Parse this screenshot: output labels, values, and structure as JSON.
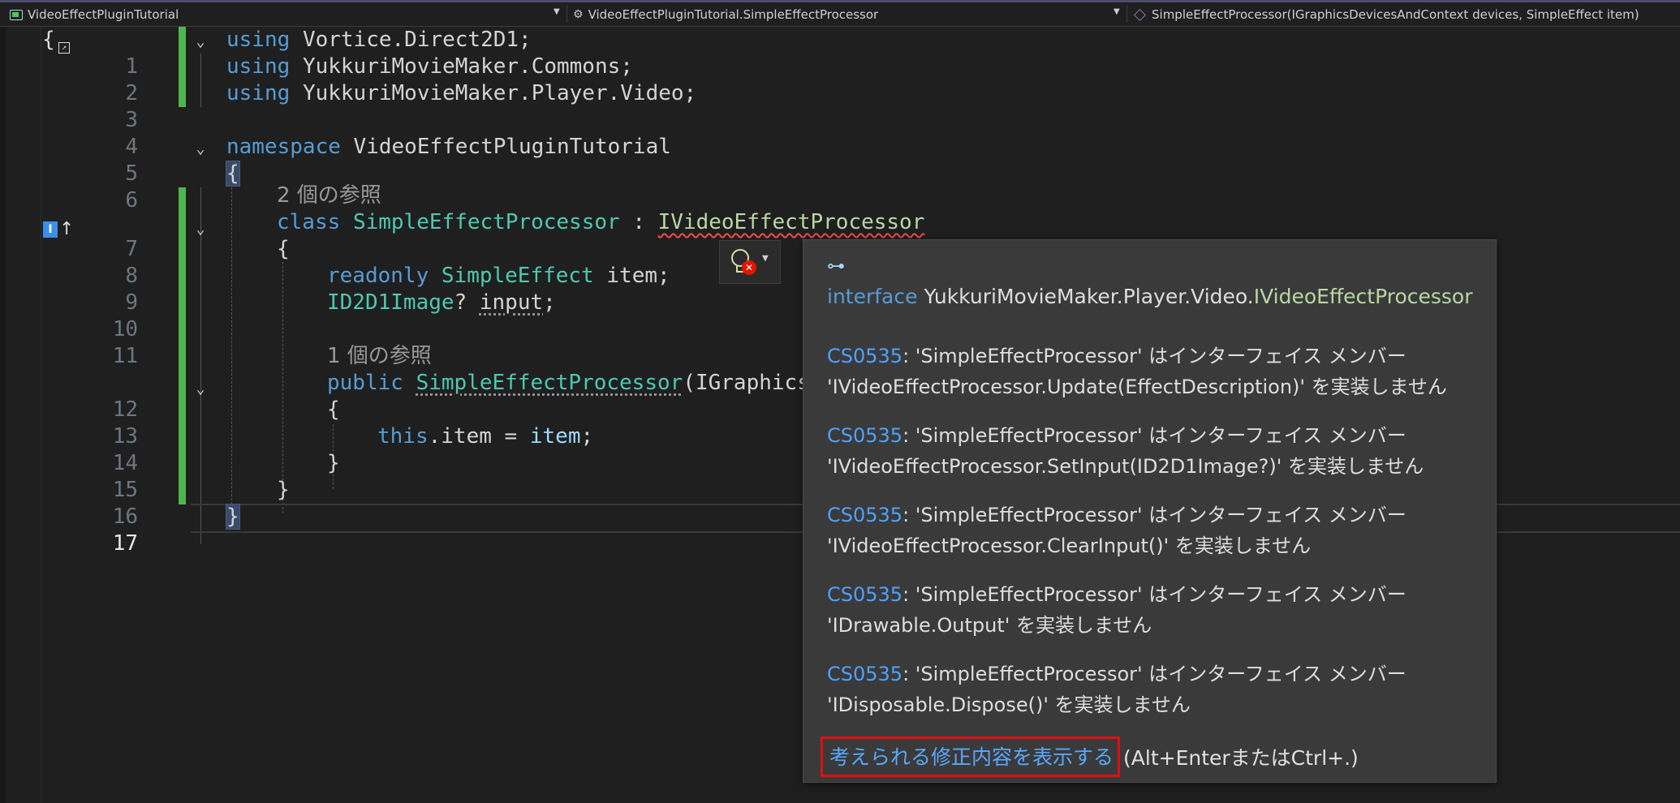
{
  "navbar": {
    "project": "VideoEffectPluginTutorial",
    "class": "VideoEffectPluginTutorial.SimpleEffectProcessor",
    "member": "SimpleEffectProcessor(IGraphicsDevicesAndContext devices, SimpleEffect item)"
  },
  "editor": {
    "line_numbers": [
      "1",
      "2",
      "3",
      "4",
      "5",
      "6",
      "7",
      "8",
      "9",
      "10",
      "11",
      "12",
      "13",
      "14",
      "15",
      "16",
      "17"
    ],
    "codelens": {
      "class_refs": "2 個の参照",
      "ctor_refs": "1 個の参照"
    },
    "tokens": {
      "using": "using",
      "ns1": "Vortice.Direct2D1;",
      "ns2": "YukkuriMovieMaker.Commons;",
      "ns3": "YukkuriMovieMaker.Player.Video;",
      "namespace_kw": "namespace",
      "namespace_name": "VideoEffectPluginTutorial",
      "open_brace": "{",
      "close_brace": "}",
      "class_kw": "class",
      "class_name": "SimpleEffectProcessor",
      "colon": " : ",
      "interface_name": "IVideoEffectProcessor",
      "readonly_kw": "readonly",
      "field_type": "SimpleEffect",
      "field_name": " item;",
      "image_type": "ID2D1Image",
      "image_rest_a": "? ",
      "image_field": "input",
      "image_rest_b": ";",
      "public_kw": "public",
      "ctor_name": "SimpleEffectProcessor",
      "ctor_param": "(IGraphicsD",
      "this_kw": "this",
      "assign_a": ".item = ",
      "assign_b": "item",
      "assign_c": ";"
    }
  },
  "tooltip": {
    "icon": "interface-icon",
    "signature_kw": "interface",
    "signature_ns": "YukkuriMovieMaker.Player.Video.",
    "signature_name": "IVideoEffectProcessor",
    "diagnostics": [
      {
        "code": "CS0535",
        "line1": ": 'SimpleEffectProcessor' はインターフェイス メンバー",
        "line2": "'IVideoEffectProcessor.Update(EffectDescription)' を実装しません"
      },
      {
        "code": "CS0535",
        "line1": ": 'SimpleEffectProcessor' はインターフェイス メンバー",
        "line2": "'IVideoEffectProcessor.SetInput(ID2D1Image?)' を実装しません"
      },
      {
        "code": "CS0535",
        "line1": ": 'SimpleEffectProcessor' はインターフェイス メンバー",
        "line2": "'IVideoEffectProcessor.ClearInput()' を実装しません"
      },
      {
        "code": "CS0535",
        "line1": ": 'SimpleEffectProcessor' はインターフェイス メンバー",
        "line2": "'IDrawable.Output' を実装しません"
      },
      {
        "code": "CS0535",
        "line1": ": 'SimpleEffectProcessor' はインターフェイス メンバー",
        "line2": "'IDisposable.Dispose()' を実装しません"
      }
    ],
    "fix_link": "考えられる修正内容を表示する",
    "fix_shortcut": "(Alt+EnterまたはCtrl+.)"
  },
  "colors": {
    "background": "#1f1f1f",
    "keyword": "#569cd6",
    "type": "#4ec9b0",
    "interface": "#b8d7a3",
    "change_bar": "#4fb54f",
    "highlight_box": "#e01010"
  }
}
